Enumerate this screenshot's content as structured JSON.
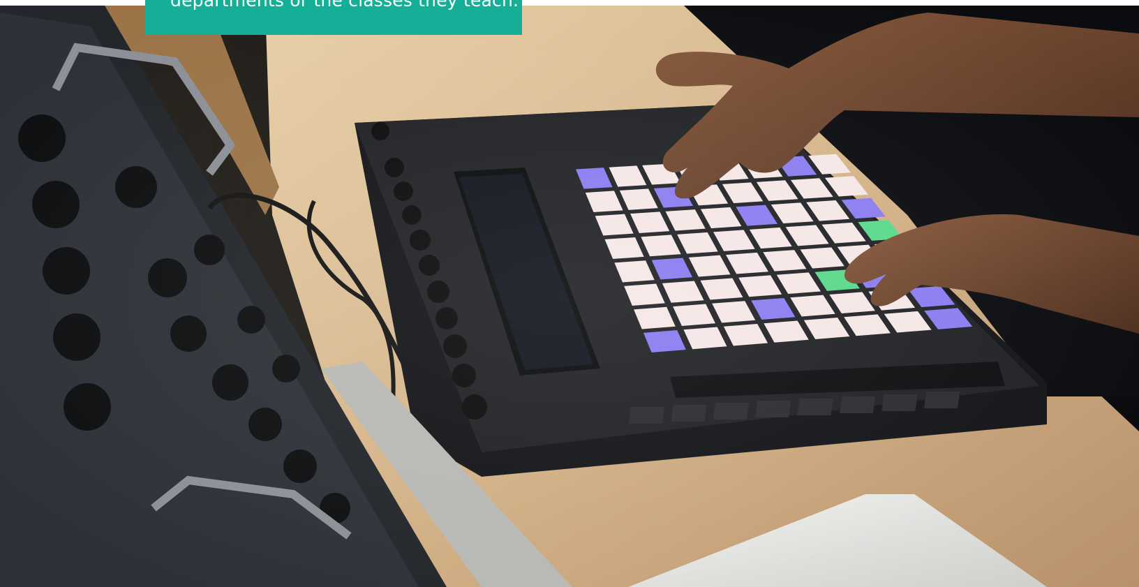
{
  "callout": {
    "text": "departments or the classes they teach."
  },
  "hero": {
    "icon": "photo-music-controller",
    "colors": {
      "background_dark": "#0b0d10",
      "desk_wood": "#d9b98f",
      "device_body": "#1c1e22",
      "pad_white": "#f6e7e6",
      "pad_purple": "#8b7cf0",
      "pad_green": "#59d98a",
      "callout_teal": "#15ae96"
    }
  }
}
